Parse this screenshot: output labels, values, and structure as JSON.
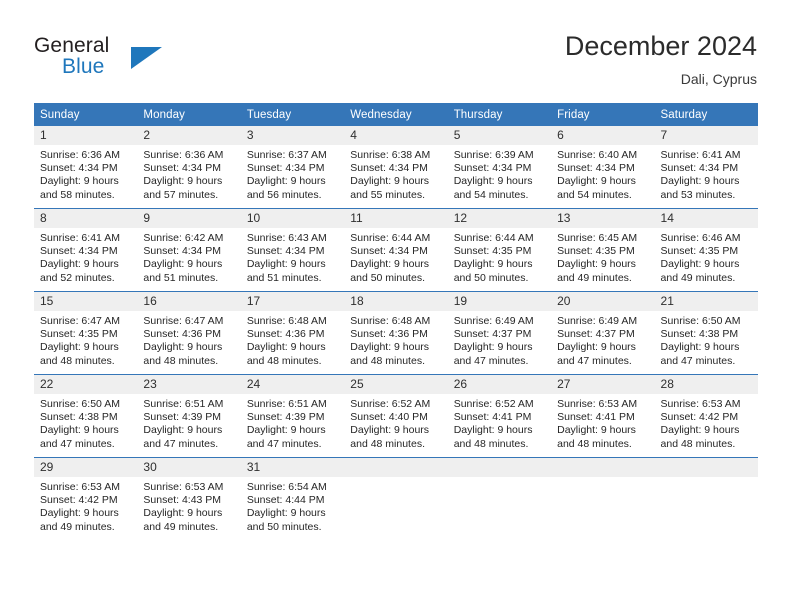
{
  "brand": {
    "name_part1": "General",
    "name_part2": "Blue",
    "triangle_icon": "brand-triangle-icon",
    "color_text": "#231f20",
    "color_accent": "#1f77bc"
  },
  "header": {
    "title": "December 2024",
    "subtitle": "Dali, Cyprus"
  },
  "theme": {
    "header_bg": "#3576b8",
    "header_text": "#ffffff",
    "daynum_band_bg": "#efefef",
    "week_separator": "#3576b8",
    "cell_bg": "#ffffff",
    "body_text": "#262626"
  },
  "calendar": {
    "weekday_headers": [
      "Sunday",
      "Monday",
      "Tuesday",
      "Wednesday",
      "Thursday",
      "Friday",
      "Saturday"
    ],
    "weeks": [
      [
        {
          "day": "1",
          "sunrise": "Sunrise: 6:36 AM",
          "sunset": "Sunset: 4:34 PM",
          "daylight_line1": "Daylight: 9 hours",
          "daylight_line2": "and 58 minutes."
        },
        {
          "day": "2",
          "sunrise": "Sunrise: 6:36 AM",
          "sunset": "Sunset: 4:34 PM",
          "daylight_line1": "Daylight: 9 hours",
          "daylight_line2": "and 57 minutes."
        },
        {
          "day": "3",
          "sunrise": "Sunrise: 6:37 AM",
          "sunset": "Sunset: 4:34 PM",
          "daylight_line1": "Daylight: 9 hours",
          "daylight_line2": "and 56 minutes."
        },
        {
          "day": "4",
          "sunrise": "Sunrise: 6:38 AM",
          "sunset": "Sunset: 4:34 PM",
          "daylight_line1": "Daylight: 9 hours",
          "daylight_line2": "and 55 minutes."
        },
        {
          "day": "5",
          "sunrise": "Sunrise: 6:39 AM",
          "sunset": "Sunset: 4:34 PM",
          "daylight_line1": "Daylight: 9 hours",
          "daylight_line2": "and 54 minutes."
        },
        {
          "day": "6",
          "sunrise": "Sunrise: 6:40 AM",
          "sunset": "Sunset: 4:34 PM",
          "daylight_line1": "Daylight: 9 hours",
          "daylight_line2": "and 54 minutes."
        },
        {
          "day": "7",
          "sunrise": "Sunrise: 6:41 AM",
          "sunset": "Sunset: 4:34 PM",
          "daylight_line1": "Daylight: 9 hours",
          "daylight_line2": "and 53 minutes."
        }
      ],
      [
        {
          "day": "8",
          "sunrise": "Sunrise: 6:41 AM",
          "sunset": "Sunset: 4:34 PM",
          "daylight_line1": "Daylight: 9 hours",
          "daylight_line2": "and 52 minutes."
        },
        {
          "day": "9",
          "sunrise": "Sunrise: 6:42 AM",
          "sunset": "Sunset: 4:34 PM",
          "daylight_line1": "Daylight: 9 hours",
          "daylight_line2": "and 51 minutes."
        },
        {
          "day": "10",
          "sunrise": "Sunrise: 6:43 AM",
          "sunset": "Sunset: 4:34 PM",
          "daylight_line1": "Daylight: 9 hours",
          "daylight_line2": "and 51 minutes."
        },
        {
          "day": "11",
          "sunrise": "Sunrise: 6:44 AM",
          "sunset": "Sunset: 4:34 PM",
          "daylight_line1": "Daylight: 9 hours",
          "daylight_line2": "and 50 minutes."
        },
        {
          "day": "12",
          "sunrise": "Sunrise: 6:44 AM",
          "sunset": "Sunset: 4:35 PM",
          "daylight_line1": "Daylight: 9 hours",
          "daylight_line2": "and 50 minutes."
        },
        {
          "day": "13",
          "sunrise": "Sunrise: 6:45 AM",
          "sunset": "Sunset: 4:35 PM",
          "daylight_line1": "Daylight: 9 hours",
          "daylight_line2": "and 49 minutes."
        },
        {
          "day": "14",
          "sunrise": "Sunrise: 6:46 AM",
          "sunset": "Sunset: 4:35 PM",
          "daylight_line1": "Daylight: 9 hours",
          "daylight_line2": "and 49 minutes."
        }
      ],
      [
        {
          "day": "15",
          "sunrise": "Sunrise: 6:47 AM",
          "sunset": "Sunset: 4:35 PM",
          "daylight_line1": "Daylight: 9 hours",
          "daylight_line2": "and 48 minutes."
        },
        {
          "day": "16",
          "sunrise": "Sunrise: 6:47 AM",
          "sunset": "Sunset: 4:36 PM",
          "daylight_line1": "Daylight: 9 hours",
          "daylight_line2": "and 48 minutes."
        },
        {
          "day": "17",
          "sunrise": "Sunrise: 6:48 AM",
          "sunset": "Sunset: 4:36 PM",
          "daylight_line1": "Daylight: 9 hours",
          "daylight_line2": "and 48 minutes."
        },
        {
          "day": "18",
          "sunrise": "Sunrise: 6:48 AM",
          "sunset": "Sunset: 4:36 PM",
          "daylight_line1": "Daylight: 9 hours",
          "daylight_line2": "and 48 minutes."
        },
        {
          "day": "19",
          "sunrise": "Sunrise: 6:49 AM",
          "sunset": "Sunset: 4:37 PM",
          "daylight_line1": "Daylight: 9 hours",
          "daylight_line2": "and 47 minutes."
        },
        {
          "day": "20",
          "sunrise": "Sunrise: 6:49 AM",
          "sunset": "Sunset: 4:37 PM",
          "daylight_line1": "Daylight: 9 hours",
          "daylight_line2": "and 47 minutes."
        },
        {
          "day": "21",
          "sunrise": "Sunrise: 6:50 AM",
          "sunset": "Sunset: 4:38 PM",
          "daylight_line1": "Daylight: 9 hours",
          "daylight_line2": "and 47 minutes."
        }
      ],
      [
        {
          "day": "22",
          "sunrise": "Sunrise: 6:50 AM",
          "sunset": "Sunset: 4:38 PM",
          "daylight_line1": "Daylight: 9 hours",
          "daylight_line2": "and 47 minutes."
        },
        {
          "day": "23",
          "sunrise": "Sunrise: 6:51 AM",
          "sunset": "Sunset: 4:39 PM",
          "daylight_line1": "Daylight: 9 hours",
          "daylight_line2": "and 47 minutes."
        },
        {
          "day": "24",
          "sunrise": "Sunrise: 6:51 AM",
          "sunset": "Sunset: 4:39 PM",
          "daylight_line1": "Daylight: 9 hours",
          "daylight_line2": "and 47 minutes."
        },
        {
          "day": "25",
          "sunrise": "Sunrise: 6:52 AM",
          "sunset": "Sunset: 4:40 PM",
          "daylight_line1": "Daylight: 9 hours",
          "daylight_line2": "and 48 minutes."
        },
        {
          "day": "26",
          "sunrise": "Sunrise: 6:52 AM",
          "sunset": "Sunset: 4:41 PM",
          "daylight_line1": "Daylight: 9 hours",
          "daylight_line2": "and 48 minutes."
        },
        {
          "day": "27",
          "sunrise": "Sunrise: 6:53 AM",
          "sunset": "Sunset: 4:41 PM",
          "daylight_line1": "Daylight: 9 hours",
          "daylight_line2": "and 48 minutes."
        },
        {
          "day": "28",
          "sunrise": "Sunrise: 6:53 AM",
          "sunset": "Sunset: 4:42 PM",
          "daylight_line1": "Daylight: 9 hours",
          "daylight_line2": "and 48 minutes."
        }
      ],
      [
        {
          "day": "29",
          "sunrise": "Sunrise: 6:53 AM",
          "sunset": "Sunset: 4:42 PM",
          "daylight_line1": "Daylight: 9 hours",
          "daylight_line2": "and 49 minutes."
        },
        {
          "day": "30",
          "sunrise": "Sunrise: 6:53 AM",
          "sunset": "Sunset: 4:43 PM",
          "daylight_line1": "Daylight: 9 hours",
          "daylight_line2": "and 49 minutes."
        },
        {
          "day": "31",
          "sunrise": "Sunrise: 6:54 AM",
          "sunset": "Sunset: 4:44 PM",
          "daylight_line1": "Daylight: 9 hours",
          "daylight_line2": "and 50 minutes."
        },
        {
          "day": "",
          "sunrise": "",
          "sunset": "",
          "daylight_line1": "",
          "daylight_line2": ""
        },
        {
          "day": "",
          "sunrise": "",
          "sunset": "",
          "daylight_line1": "",
          "daylight_line2": ""
        },
        {
          "day": "",
          "sunrise": "",
          "sunset": "",
          "daylight_line1": "",
          "daylight_line2": ""
        },
        {
          "day": "",
          "sunrise": "",
          "sunset": "",
          "daylight_line1": "",
          "daylight_line2": ""
        }
      ]
    ]
  }
}
